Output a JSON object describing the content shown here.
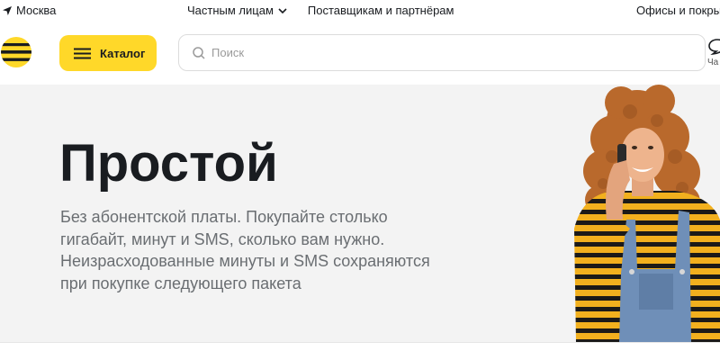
{
  "topbar": {
    "city": "Москва",
    "nav": [
      {
        "label": "Частным лицам",
        "has_dropdown": true
      },
      {
        "label": "Поставщикам и партнёрам",
        "has_dropdown": false
      }
    ],
    "offices": "Офисы и покры"
  },
  "header": {
    "catalog_label": "Каталог",
    "search_placeholder": "Поиск",
    "chat_label": "Ча"
  },
  "hero": {
    "title": "Простой",
    "description": "Без абонентской платы. Покупайте столько гигабайт, минут и SMS, сколько вам нужно. Неизрасходованные минуты и SMS сохраняются при покупке следующего пакета"
  },
  "colors": {
    "brand_yellow": "#ffd829",
    "text": "#191c20",
    "muted_text": "#6a6e72",
    "hero_bg": "#f3f3f3"
  },
  "icons": [
    "location-arrow-icon",
    "chevron-down-icon",
    "beeline-logo-icon",
    "hamburger-icon",
    "search-icon",
    "chat-icon"
  ]
}
